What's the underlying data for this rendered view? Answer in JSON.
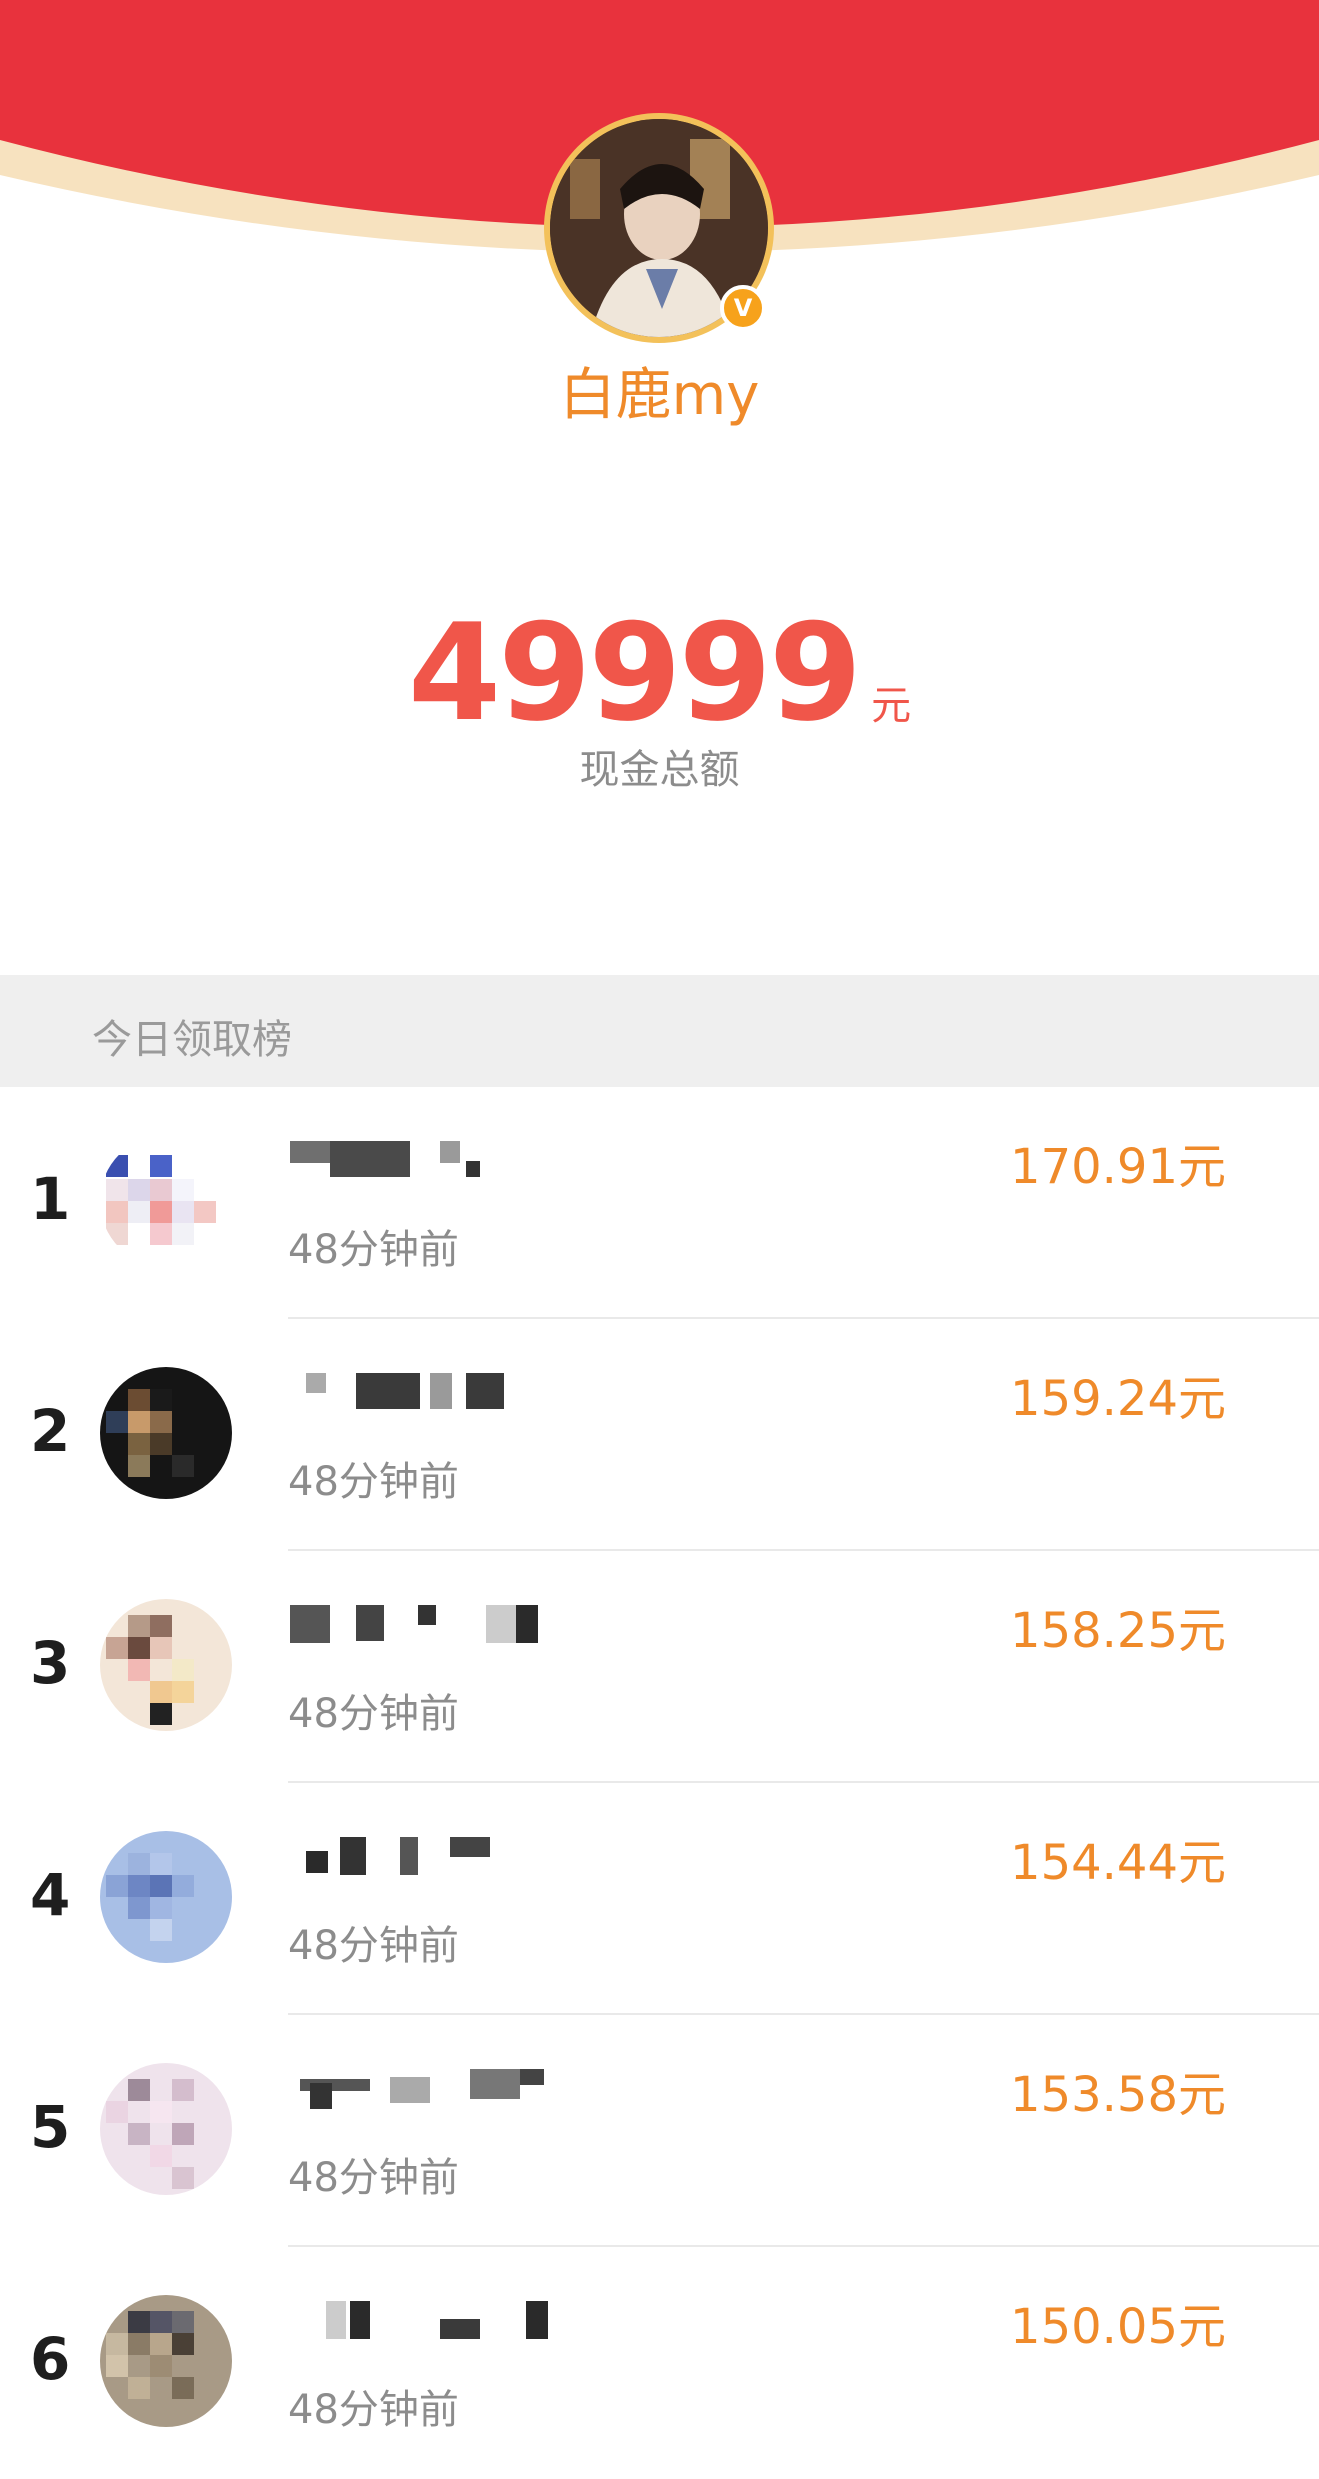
{
  "profile": {
    "name": "白鹿my",
    "verified_mark": "V"
  },
  "summary": {
    "amount": "49999",
    "unit": "元",
    "label": "现金总额"
  },
  "leaderboard": {
    "title": "今日领取榜",
    "rows": [
      {
        "rank": "1",
        "time": "48分钟前",
        "amount": "170.91元"
      },
      {
        "rank": "2",
        "time": "48分钟前",
        "amount": "159.24元"
      },
      {
        "rank": "3",
        "time": "48分钟前",
        "amount": "158.25元"
      },
      {
        "rank": "4",
        "time": "48分钟前",
        "amount": "154.44元"
      },
      {
        "rank": "5",
        "time": "48分钟前",
        "amount": "153.58元"
      },
      {
        "rank": "6",
        "time": "48分钟前",
        "amount": "150.05元"
      }
    ]
  },
  "colors": {
    "banner_red": "#e8323d",
    "banner_rim": "#f7e2bf",
    "accent_orange": "#ef8a2a",
    "amount_red": "#f0564a",
    "muted_gray": "#8c8c8c",
    "header_bg": "#efefef"
  }
}
